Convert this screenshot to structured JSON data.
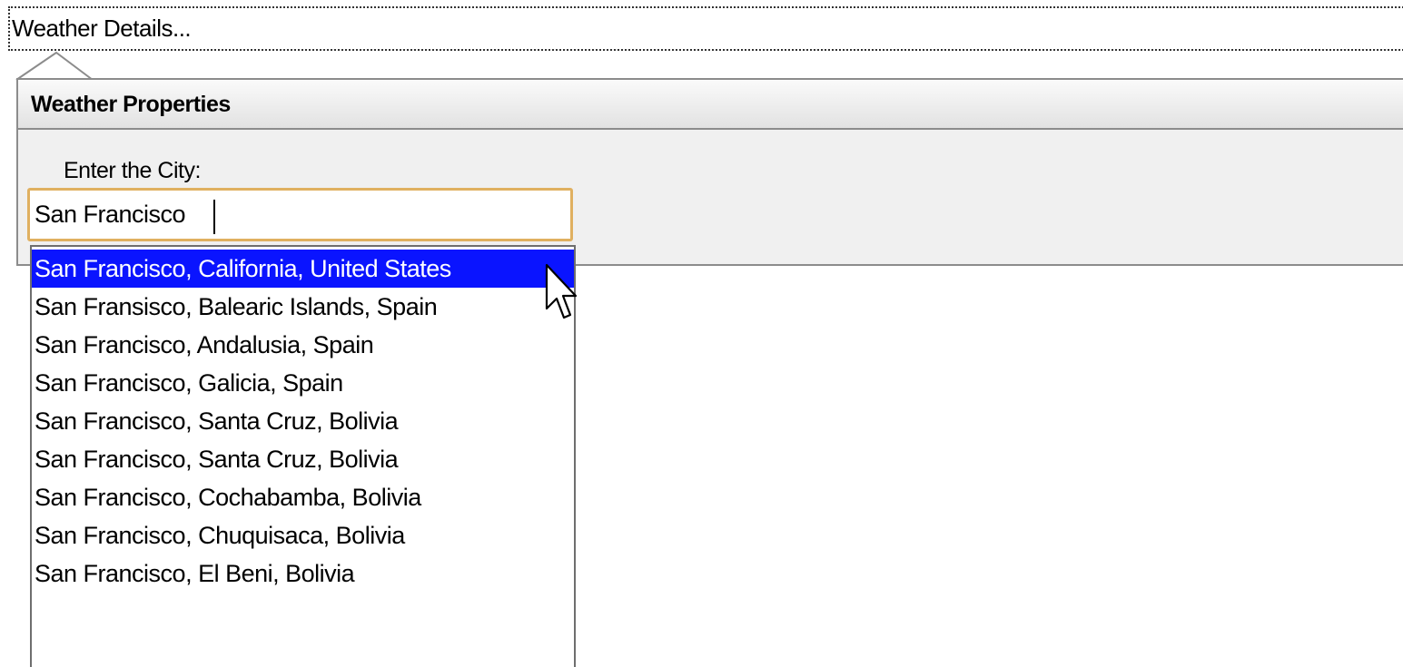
{
  "header": {
    "link_label": "Weather Details..."
  },
  "panel": {
    "title": "Weather Properties",
    "city_label": "Enter the City:",
    "city_value": "San Francisco"
  },
  "suggestions": {
    "selected_index": 0,
    "items": [
      "San Francisco, California, United States",
      "San Fransisco, Balearic Islands, Spain",
      "San Francisco, Andalusia, Spain",
      "San Francisco, Galicia, Spain",
      "San Francisco, Santa Cruz, Bolivia",
      "San Francisco, Santa Cruz, Bolivia",
      "San Francisco, Cochabamba, Bolivia",
      "San Francisco, Chuquisaca, Bolivia",
      "San Francisco, El Beni, Bolivia"
    ]
  },
  "colors": {
    "selection_bg": "#0a14ff",
    "input_focus_border": "#e0b060"
  },
  "icons": {
    "callout": "callout-arrow-icon",
    "pointer": "mouse-pointer-icon"
  }
}
